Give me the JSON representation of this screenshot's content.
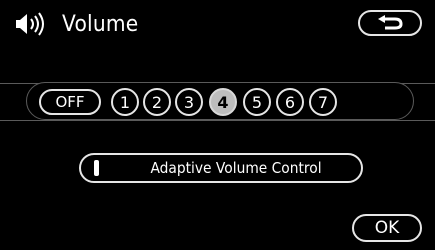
{
  "header": {
    "icon": "speaker-volume-icon",
    "title": "Volume",
    "back_icon": "return-arrow-icon"
  },
  "volume": {
    "off_label": "OFF",
    "levels": [
      "1",
      "2",
      "3",
      "4",
      "5",
      "6",
      "7"
    ],
    "selected": "4"
  },
  "avc": {
    "label": "Adaptive Volume Control",
    "indicator_on": true
  },
  "footer": {
    "ok_label": "OK"
  },
  "colors": {
    "background": "#000000",
    "outline": "#e6e6e6",
    "selected_fill": "#bdbdbd"
  }
}
